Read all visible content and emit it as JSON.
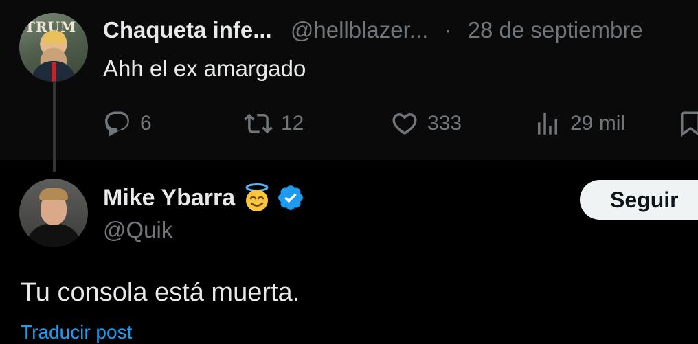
{
  "parent_tweet": {
    "display_name": "Chaqueta infe...",
    "handle": "@hellblazer...",
    "separator": "·",
    "date": "28 de septiembre",
    "avatar_text": "TRUM",
    "text": "Ahh el ex amargado",
    "actions": {
      "replies": "6",
      "reposts": "12",
      "likes": "333",
      "views": "29 mil"
    }
  },
  "reply_tweet": {
    "display_name": "Mike Ybarra",
    "handle": "@Quik",
    "follow_label": "Seguir",
    "text": "Tu consola está muerta.",
    "translate_label": "Traducir post"
  },
  "icons": {
    "reply": "reply-icon",
    "repost": "repost-icon",
    "like": "like-icon",
    "views": "views-icon",
    "bookmark": "bookmark-icon",
    "verified": "verified-badge-icon",
    "emoji": "smiling-face-with-halo-icon"
  },
  "colors": {
    "background": "#000000",
    "text": "#e7e9ea",
    "muted": "#71767b",
    "accent": "#1d9bf0",
    "follow_bg": "#eff3f4"
  }
}
